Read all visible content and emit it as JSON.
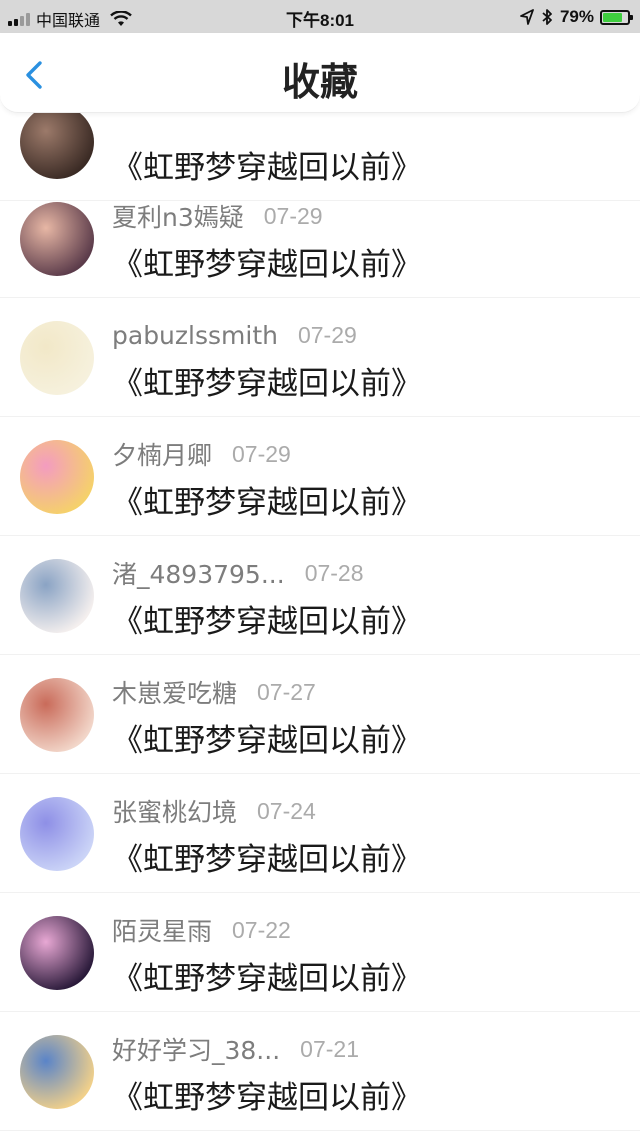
{
  "status_bar": {
    "carrier": "中国联通",
    "time": "下午8:01",
    "battery_percent": "79%",
    "battery_level": 0.79,
    "icons": [
      "signal-icon",
      "wifi-icon",
      "location-icon",
      "bluetooth-icon",
      "battery-icon"
    ]
  },
  "nav": {
    "title": "收藏",
    "back_icon": "chevron-left-icon",
    "accent": "#2a90e0"
  },
  "items": [
    {
      "name": "",
      "date": "",
      "title": "《虹野梦穿越回以前》",
      "avatar_colors": [
        "#3a2a24",
        "#9c7a6a"
      ]
    },
    {
      "name": "夏利n3嫣疑",
      "date": "07-29",
      "title": "《虹野梦穿越回以前》",
      "avatar_colors": [
        "#5b3b4a",
        "#e7b7a5"
      ]
    },
    {
      "name": "pabuzlssmith",
      "date": "07-29",
      "title": "《虹野梦穿越回以前》",
      "avatar_colors": [
        "#f6f1dd",
        "#f2e8c8"
      ]
    },
    {
      "name": "夕楠月卿",
      "date": "07-29",
      "title": "《虹野梦穿越回以前》",
      "avatar_colors": [
        "#f5d16a",
        "#f39cc0"
      ]
    },
    {
      "name": "渚_4893795...",
      "date": "07-28",
      "title": "《虹野梦穿越回以前》",
      "avatar_colors": [
        "#f4efee",
        "#8aa3c4"
      ]
    },
    {
      "name": "木崽爱吃糖",
      "date": "07-27",
      "title": "《虹野梦穿越回以前》",
      "avatar_colors": [
        "#f2d6c9",
        "#c96b5a"
      ]
    },
    {
      "name": "张蜜桃幻境",
      "date": "07-24",
      "title": "《虹野梦穿越回以前》",
      "avatar_colors": [
        "#cbd4f7",
        "#8e8fe6"
      ]
    },
    {
      "name": "陌灵星雨",
      "date": "07-22",
      "title": "《虹野梦穿越回以前》",
      "avatar_colors": [
        "#2a1a3a",
        "#e8a8d4"
      ]
    },
    {
      "name": "好好学习_38...",
      "date": "07-21",
      "title": "《虹野梦穿越回以前》",
      "avatar_colors": [
        "#f1d08a",
        "#5a84c8"
      ]
    }
  ]
}
